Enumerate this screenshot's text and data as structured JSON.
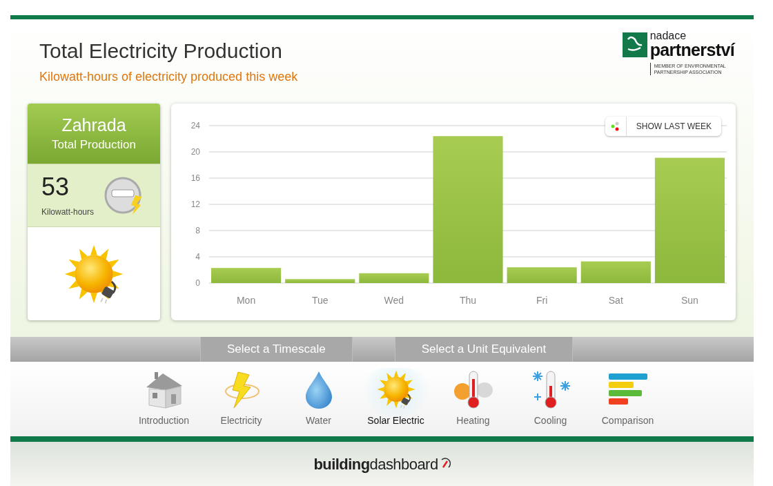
{
  "header": {
    "title": "Total Electricity Production",
    "subtitle": "Kilowatt-hours of electricity produced this week"
  },
  "logo": {
    "name_top": "nadace",
    "name_main": "partnerství",
    "tagline_1": "MEMBER OF ENVIRONMENTAL",
    "tagline_2": "PARTNERSHIP ASSOCIATION"
  },
  "summary": {
    "building": "Zahrada",
    "label": "Total Production",
    "value": "53",
    "unit": "Kilowatt-hours"
  },
  "chart": {
    "button": "SHOW LAST WEEK",
    "chart_data": {
      "type": "bar",
      "categories": [
        "Mon",
        "Tue",
        "Wed",
        "Thu",
        "Fri",
        "Sat",
        "Sun"
      ],
      "grid": true,
      "series": [
        {
          "color": "#8cb83c",
          "values": [
            2.3,
            0.6,
            1.5,
            22.4,
            2.4,
            3.3,
            19.1
          ]
        }
      ],
      "ylim": [
        0,
        24
      ],
      "yticks": [
        0,
        4,
        8,
        12,
        16,
        20,
        24
      ]
    }
  },
  "selectors": [
    {
      "label": "Select a Timescale"
    },
    {
      "label": "Select a Unit Equivalent"
    }
  ],
  "nav": [
    {
      "kind": "house",
      "label": "Introduction",
      "selected": false
    },
    {
      "kind": "bolt",
      "label": "Electricity",
      "selected": false
    },
    {
      "kind": "drop",
      "label": "Water",
      "selected": false
    },
    {
      "kind": "sun",
      "label": "Solar Electric",
      "selected": true
    },
    {
      "kind": "heat",
      "label": "Heating",
      "selected": false
    },
    {
      "kind": "cool",
      "label": "Cooling",
      "selected": false
    },
    {
      "kind": "bars",
      "label": "Comparison",
      "selected": false
    }
  ],
  "footer": {
    "brand": "**building**dashboard"
  }
}
